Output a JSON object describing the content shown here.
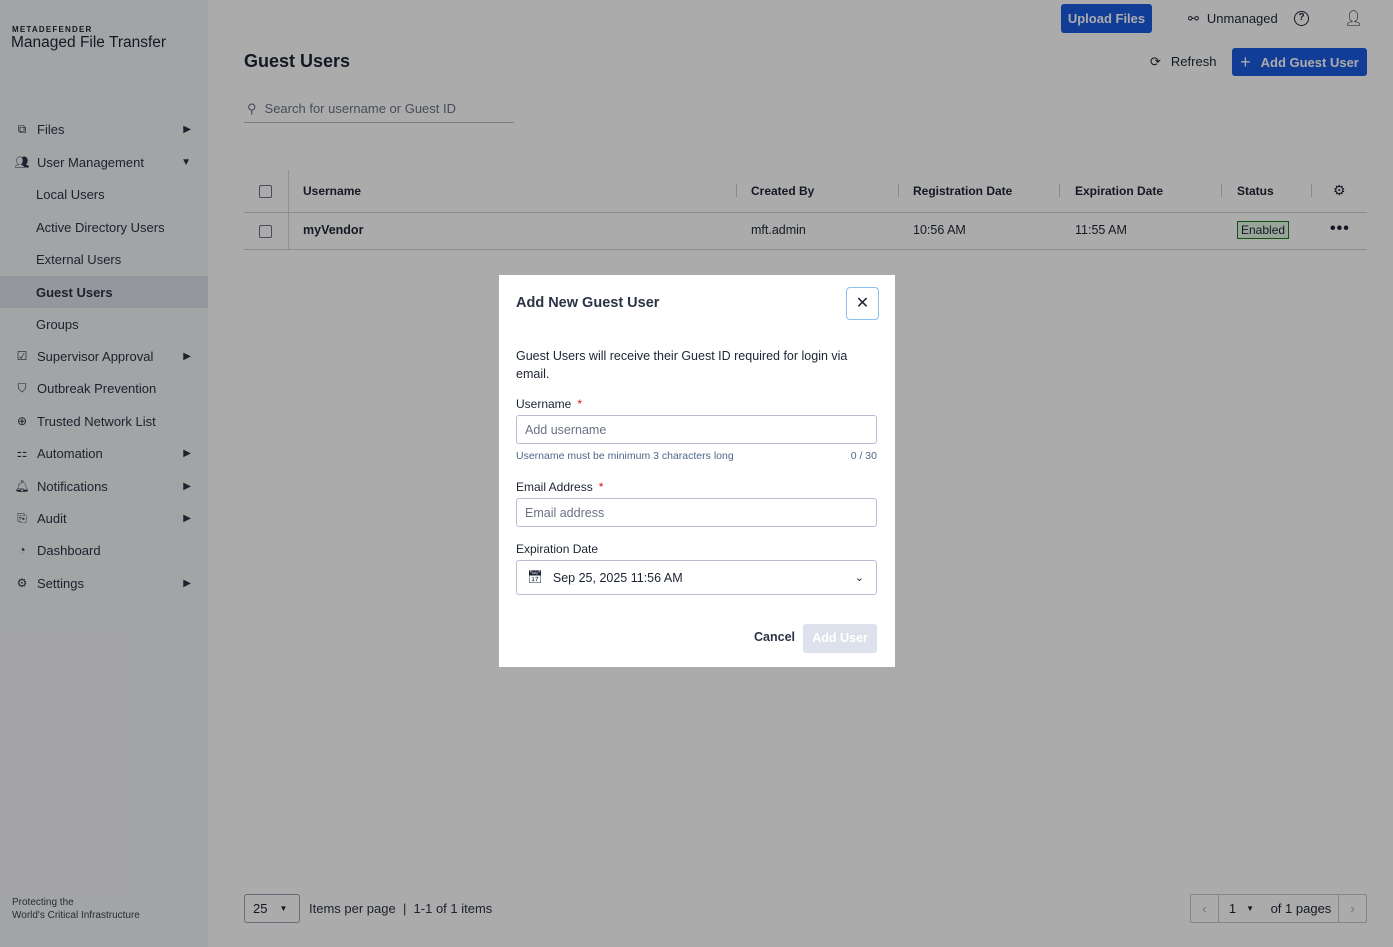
{
  "brand": {
    "small": "METADEFENDER",
    "name": "Managed File Transfer",
    "tagline1": "Protecting the",
    "tagline2": "World's Critical Infrastructure"
  },
  "sidebar": {
    "items": [
      {
        "label": "Files"
      },
      {
        "label": "User Management"
      },
      {
        "label": "Local Users"
      },
      {
        "label": "Active Directory Users"
      },
      {
        "label": "External Users"
      },
      {
        "label": "Guest Users"
      },
      {
        "label": "Groups"
      },
      {
        "label": "Supervisor Approval"
      },
      {
        "label": "Outbreak Prevention"
      },
      {
        "label": "Trusted Network List"
      },
      {
        "label": "Automation"
      },
      {
        "label": "Notifications"
      },
      {
        "label": "Audit"
      },
      {
        "label": "Dashboard"
      },
      {
        "label": "Settings"
      }
    ]
  },
  "header": {
    "upload": "Upload Files",
    "unmanaged": "Unmanaged"
  },
  "page": {
    "title": "Guest Users",
    "refresh": "Refresh",
    "add": "Add Guest User",
    "search_placeholder": "Search for username or Guest ID"
  },
  "table": {
    "columns": [
      "Username",
      "Created By",
      "Registration Date",
      "Expiration Date",
      "Status"
    ],
    "rows": [
      {
        "username": "myVendor",
        "created_by": "mft.admin",
        "registration": "10:56 AM",
        "expiration": "11:55 AM",
        "status": "Enabled"
      }
    ]
  },
  "footer": {
    "per_page": "25",
    "per_page_label": "Items per page",
    "range": "1-1 of 1 items",
    "page": "1",
    "of_pages": "of 1 pages"
  },
  "modal": {
    "title": "Add New Guest User",
    "desc": "Guest Users will receive their Guest ID required for login via email.",
    "username_label": "Username",
    "username_placeholder": "Add username",
    "username_hint": "Username must be minimum 3 characters long",
    "counter": "0 / 30",
    "email_label": "Email Address",
    "email_placeholder": "Email address",
    "exp_label": "Expiration Date",
    "exp_value": "Sep 25, 2025 11:56 AM",
    "cancel": "Cancel",
    "submit": "Add User",
    "required": "*"
  }
}
